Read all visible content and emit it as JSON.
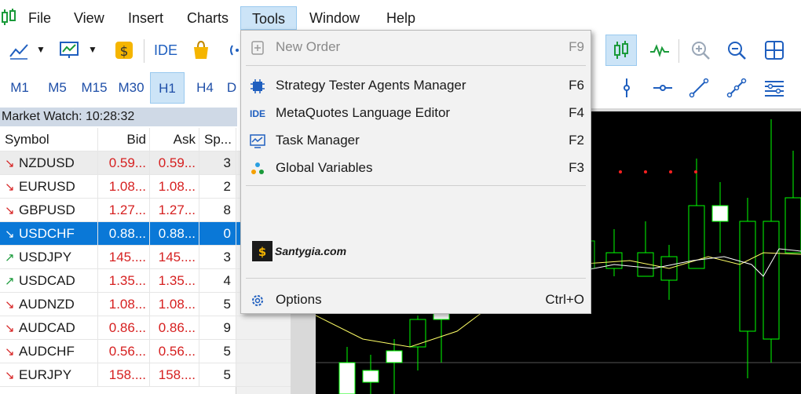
{
  "menubar": {
    "items": [
      "File",
      "View",
      "Insert",
      "Charts",
      "Tools",
      "Window",
      "Help"
    ],
    "active": "Tools"
  },
  "toolbar": {
    "ide_label": "IDE"
  },
  "timeframes": [
    "M1",
    "M5",
    "M15",
    "M30",
    "H1",
    "H4",
    "D"
  ],
  "timeframe_active": "H1",
  "market_watch": {
    "title": "Market Watch: 10:28:32",
    "columns": [
      "Symbol",
      "Bid",
      "Ask",
      "Sp..."
    ],
    "rows": [
      {
        "symbol": "NZDUSD",
        "dir": "down",
        "bid": "0.59...",
        "ask": "0.59...",
        "spread": "3"
      },
      {
        "symbol": "EURUSD",
        "dir": "down",
        "bid": "1.08...",
        "ask": "1.08...",
        "spread": "2"
      },
      {
        "symbol": "GBPUSD",
        "dir": "down",
        "bid": "1.27...",
        "ask": "1.27...",
        "spread": "8"
      },
      {
        "symbol": "USDCHF",
        "dir": "down",
        "bid": "0.88...",
        "ask": "0.88...",
        "spread": "0"
      },
      {
        "symbol": "USDJPY",
        "dir": "up",
        "bid": "145....",
        "ask": "145....",
        "spread": "3"
      },
      {
        "symbol": "USDCAD",
        "dir": "up",
        "bid": "1.35...",
        "ask": "1.35...",
        "spread": "4"
      },
      {
        "symbol": "AUDNZD",
        "dir": "down",
        "bid": "1.08...",
        "ask": "1.08...",
        "spread": "5"
      },
      {
        "symbol": "AUDCAD",
        "dir": "down",
        "bid": "0.86...",
        "ask": "0.86...",
        "spread": "9"
      },
      {
        "symbol": "AUDCHF",
        "dir": "down",
        "bid": "0.56...",
        "ask": "0.56...",
        "spread": "5"
      },
      {
        "symbol": "EURJPY",
        "dir": "down",
        "bid": "158....",
        "ask": "158....",
        "spread": "5"
      }
    ],
    "selected": "USDCHF",
    "highlighted": "NZDUSD"
  },
  "tools_menu": {
    "items": [
      {
        "label": "New Order",
        "shortcut": "F9",
        "icon": "new-order-icon",
        "disabled": true
      },
      {
        "label": "Strategy Tester Agents Manager",
        "shortcut": "F6",
        "icon": "agents-manager-icon"
      },
      {
        "label": "MetaQuotes Language Editor",
        "shortcut": "F4",
        "icon": "ide-icon"
      },
      {
        "label": "Task Manager",
        "shortcut": "F2",
        "icon": "task-manager-icon"
      },
      {
        "label": "Global Variables",
        "shortcut": "F3",
        "icon": "global-variables-icon"
      },
      {
        "label": "Options",
        "shortcut": "Ctrl+O",
        "icon": "gear-icon"
      }
    ],
    "ide_icon_text": "IDE"
  },
  "watermark": {
    "text": "Santygia.com"
  },
  "colors": {
    "accent": "#0a78d7",
    "menu_active": "#cce4f7",
    "bid_ask_red": "#d62020",
    "up_green": "#1a9a3a",
    "chart_bg": "#000000",
    "candle": "#00ff00"
  }
}
